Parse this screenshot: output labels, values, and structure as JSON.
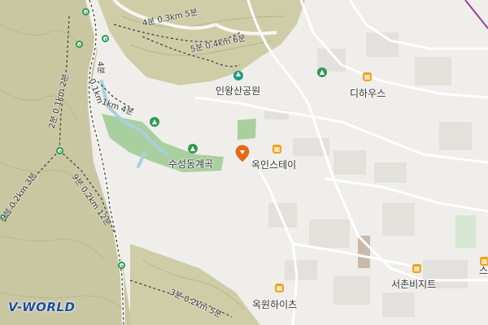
{
  "places": {
    "park": "인왕산공원",
    "valley": "수성동계곡",
    "okin_stay": "옥인스테이",
    "dihaus": "디하우스",
    "seochon_biz": "서촌비지트",
    "okwon_heights": "옥원하이츠",
    "edge_partial": "스"
  },
  "trails": {
    "t1": "4분 0.3km 5분",
    "t2": "5분 0.4km 6분",
    "t3": "4분",
    "t4": "0.1km",
    "t5": "2분 0.1km 2분",
    "t6": "9분 0.2km 3분",
    "t7": "9분 0.2km 12분",
    "t8": "3분 0.2km 5분",
    "t9": "1km 4분"
  },
  "icons": {
    "building": "building-icon",
    "tree": "tree-icon",
    "mountain": "mountain-icon",
    "park": "park-icon",
    "location": "location-pin-icon",
    "trail_marker": "trail-marker-icon"
  },
  "colors": {
    "terrain": "#c9c7a2",
    "park_green": "#a9cf9e",
    "water": "#a8d0de",
    "accent_orange": "#f0a21b",
    "poi_green": "#2e9a52",
    "pin": "#e26b17",
    "brand": "#1f4fa0"
  },
  "branding": {
    "logo": "V-WORLD"
  }
}
